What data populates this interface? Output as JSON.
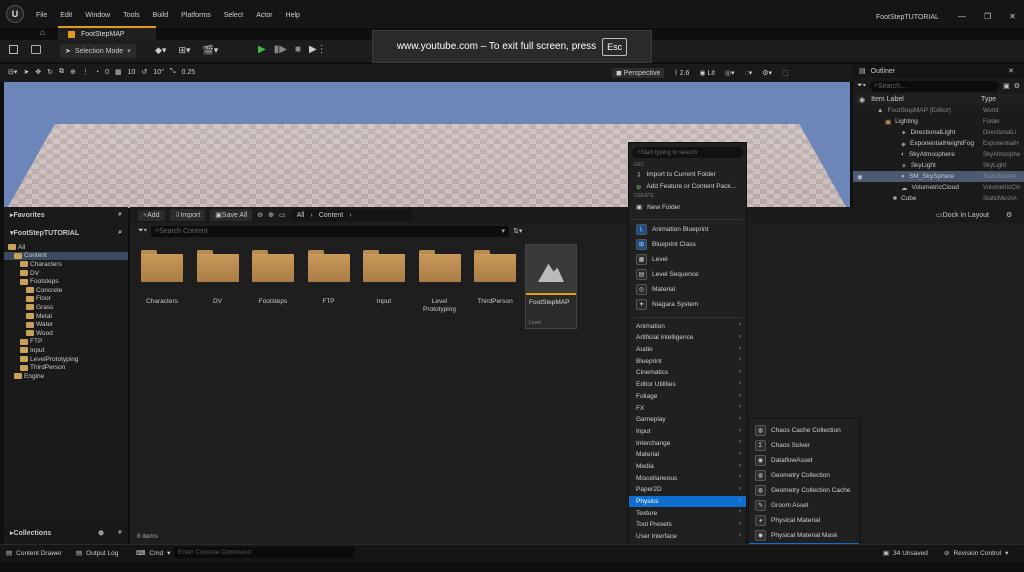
{
  "menu": [
    "File",
    "Edit",
    "Window",
    "Tools",
    "Build",
    "Platforms",
    "Select",
    "Actor",
    "Help"
  ],
  "tab_title": "FootStepMAP",
  "app_title": "FootStepTUTORIAL",
  "toolbar": {
    "selection_mode": "Selection Mode"
  },
  "overlay": {
    "text": "www.youtube.com – To exit full screen, press",
    "key": "Esc"
  },
  "viewport_bar": {
    "v1": "0",
    "v2": "10",
    "v3": "10°",
    "v4": "0.25",
    "perspective": "Perspective",
    "speed": "2.6",
    "lit": "Lit"
  },
  "outliner": {
    "title": "Outliner",
    "search": "Search...",
    "col_label": "Item Label",
    "col_type": "Type",
    "rows": [
      {
        "label": "FootStepMAP (Editor)",
        "type": "World"
      },
      {
        "label": "Lighting",
        "type": "Folder"
      },
      {
        "label": "DirectionalLight",
        "type": "DirectionalLi"
      },
      {
        "label": "ExponentialHeightFog",
        "type": "ExponentialH"
      },
      {
        "label": "SkyAtmosphere",
        "type": "SkyAtmosphe"
      },
      {
        "label": "SkyLight",
        "type": "SkyLight"
      },
      {
        "label": "SM_SkySphere",
        "type": "StaticMeshA"
      },
      {
        "label": "VolumetricCloud",
        "type": "VolumetricClo"
      },
      {
        "label": "Cube",
        "type": "StaticMeshA"
      }
    ]
  },
  "content_browser": {
    "favorites": "Favorites",
    "project": "FootStepTUTORIAL",
    "collections": "Collections",
    "tree": [
      "All",
      "Content",
      "Characters",
      "DV",
      "Footsteps",
      "Concrete",
      "Floor",
      "Grass",
      "Metal",
      "Water",
      "Wood",
      "FTP",
      "Input",
      "LevelPrototyping",
      "ThirdPerson",
      "Engine"
    ],
    "add": "Add",
    "import": "Import",
    "save_all": "Save All",
    "path_all": "All",
    "path_content": "Content",
    "search": "Search Content",
    "dock": "Dock in Layout",
    "items_count": "8 items",
    "assets": [
      "Characters",
      "DV",
      "Footsteps",
      "FTP",
      "Input",
      "Level Prototyping",
      "ThirdPerson"
    ],
    "level_asset": "FootStepMAP",
    "level_type": "Level"
  },
  "context_menu": {
    "search": "Start typing to search",
    "sec_get": "GET",
    "sec_create": "CREATE",
    "import": "Import to Current Folder",
    "add_feature": "Add Feature or Content Pack...",
    "new_folder": "New Folder",
    "create_items": [
      "Animation Blueprint",
      "Blueprint Class",
      "Level",
      "Level Sequence",
      "Material",
      "Niagara System"
    ],
    "categories": [
      "Animation",
      "Artificial Intelligence",
      "Audio",
      "Blueprint",
      "Cinematics",
      "Editor Utilities",
      "Foliage",
      "FX",
      "Gameplay",
      "Input",
      "Interchange",
      "Material",
      "Media",
      "Miscellaneous",
      "Paper2D",
      "Physics",
      "Texture",
      "Tool Presets",
      "User Interface",
      "World"
    ],
    "selected_category": "Physics"
  },
  "submenu": {
    "items": [
      "Chaos Cache Collection",
      "Chaos Solver",
      "DataflowAsset",
      "Geometry Collection",
      "Geometry Collection Cache",
      "Groom Asset",
      "Physical Material",
      "Physical Material Mask",
      "Physics Asset"
    ],
    "selected": "Physics Asset"
  },
  "statusbar": {
    "drawer": "Content Drawer",
    "output": "Output Log",
    "cmd": "Cmd",
    "console": "Enter Console Command",
    "unsaved": "34 Unsaved",
    "revision": "Revision Control"
  }
}
